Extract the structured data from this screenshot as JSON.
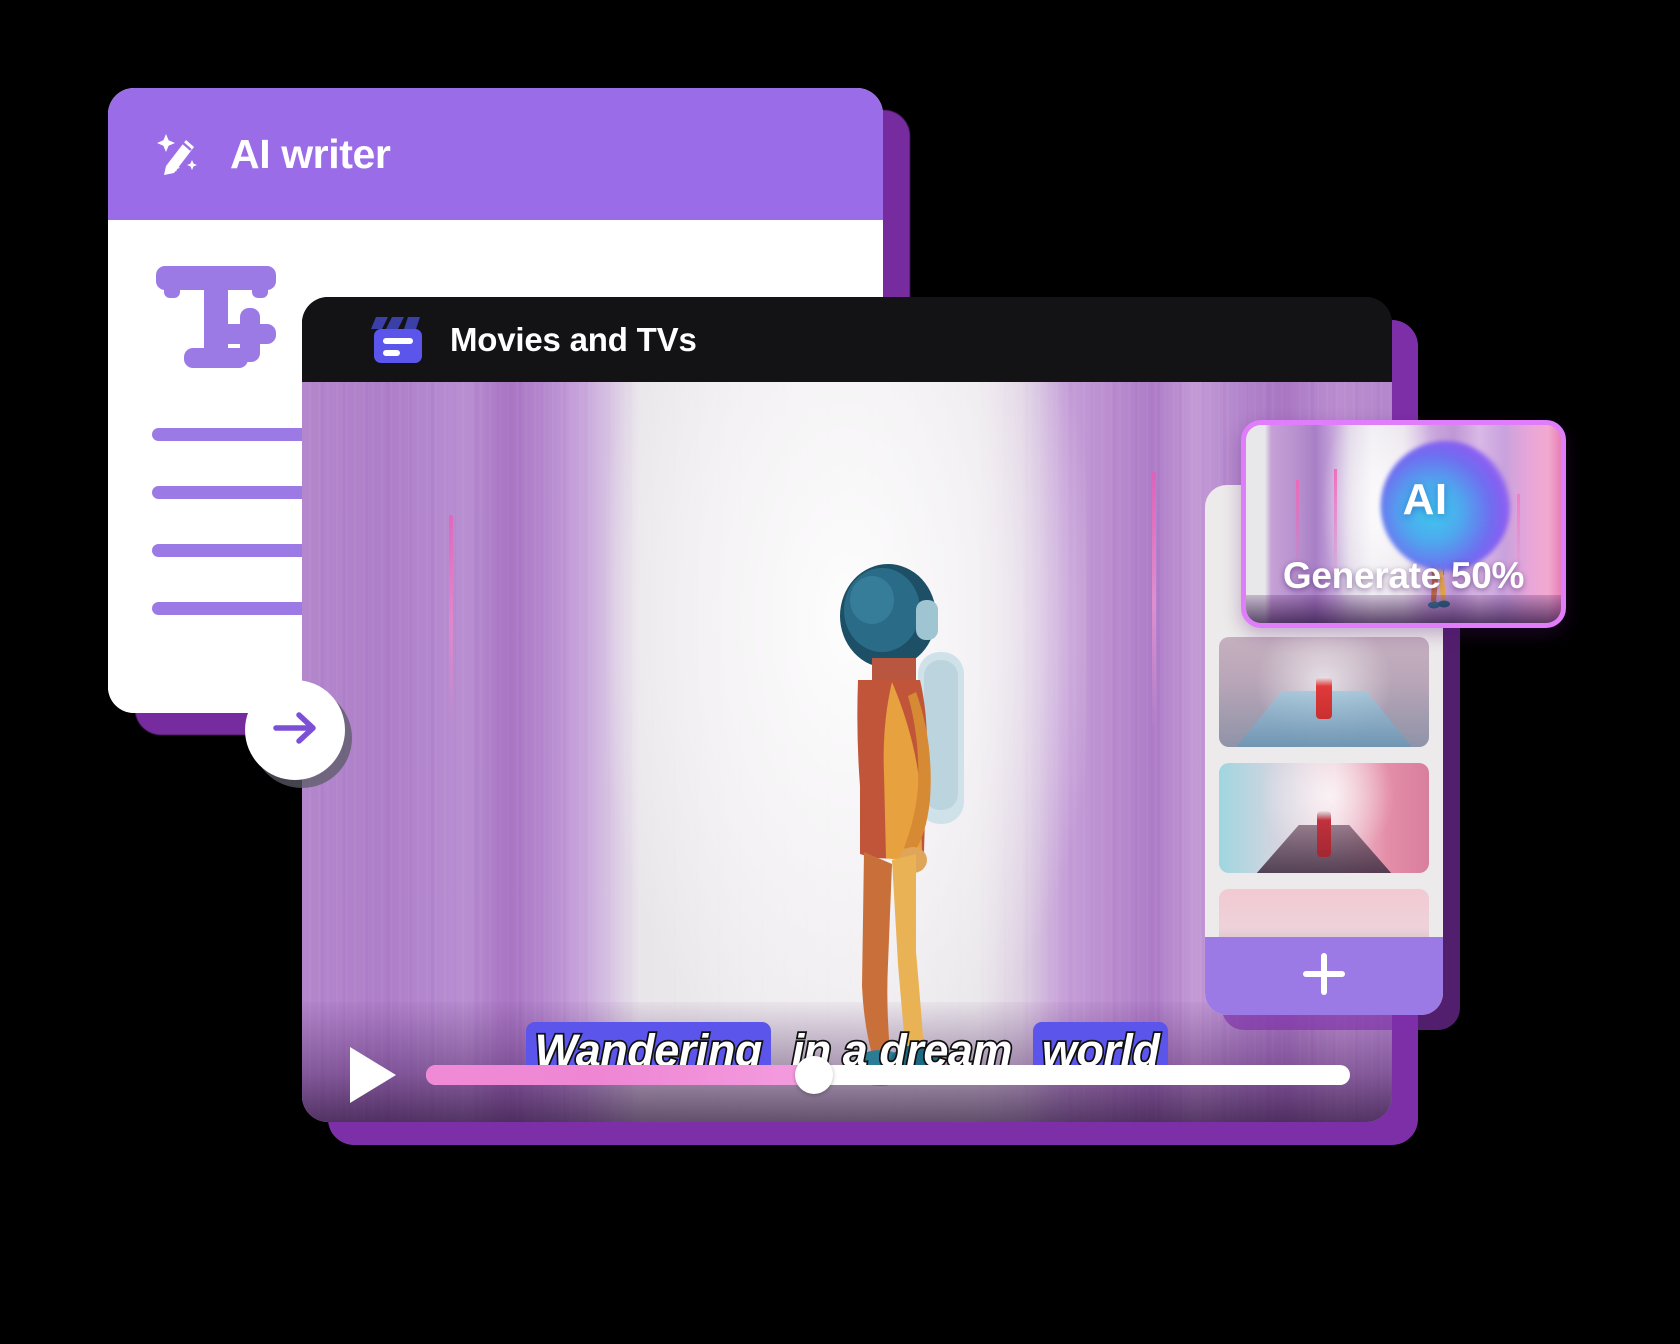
{
  "ai_writer": {
    "title": "AI writer",
    "icon": "magic-pen-icon",
    "text_tool_icon": "text-add-icon",
    "placeholder_lines": [
      "",
      "",
      "",
      ""
    ]
  },
  "next_button": {
    "icon": "arrow-right-icon",
    "label": ""
  },
  "movies_window": {
    "title": "Movies and TVs",
    "icon": "clapperboard-icon",
    "subtitle": {
      "words": [
        {
          "text": "Wandering",
          "highlighted": true
        },
        {
          "text": " in a dream ",
          "highlighted": false
        },
        {
          "text": "world",
          "highlighted": true
        }
      ],
      "full_text": "Wandering in a dream world"
    },
    "player": {
      "play_icon": "play-icon",
      "progress_percent": 42,
      "track_color": "#ffffff",
      "fill_color": "#f08ad6",
      "thumb_icon": "scrubber-handle"
    }
  },
  "ai_panel": {
    "generate_card": {
      "badge_label": "AI",
      "status_label": "Generate 50%",
      "progress_percent": 50,
      "border_color": "#e07dfa"
    },
    "thumbnails": [
      {
        "name": "thumbnail-1"
      },
      {
        "name": "thumbnail-2"
      },
      {
        "name": "thumbnail-3"
      }
    ],
    "add_button": {
      "icon": "plus-icon",
      "label": ""
    }
  },
  "colors": {
    "purple_header": "#9b6ce8",
    "purple_accent": "#9b7ae6",
    "purple_shadow": "#7d2fa8",
    "dark_header": "#131316",
    "clapper_blue": "#5b55ec",
    "subtitle_highlight": "#5b55ec",
    "panel_bg": "#eceaea",
    "pink_progress": "#f08ad6"
  }
}
